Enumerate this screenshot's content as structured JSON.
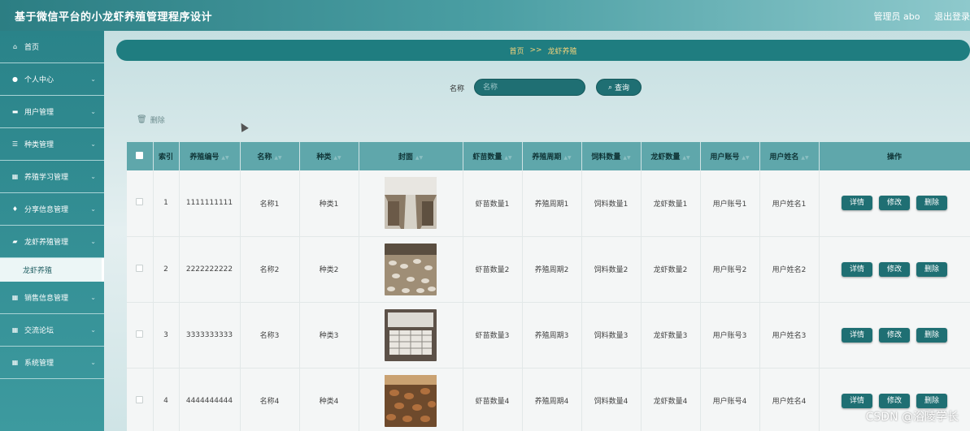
{
  "header": {
    "title": "基于微信平台的小龙虾养殖管理程序设计",
    "user_label": "管理员 abo",
    "logout_label": "退出登录"
  },
  "sidebar": {
    "items": [
      {
        "label": "首页",
        "icon": "home-icon"
      },
      {
        "label": "个人中心",
        "icon": "user-icon"
      },
      {
        "label": "用户管理",
        "icon": "id-card-icon"
      },
      {
        "label": "种类管理",
        "icon": "sliders-icon"
      },
      {
        "label": "养殖学习管理",
        "icon": "grid-icon"
      },
      {
        "label": "分享信息管理",
        "icon": "pin-icon"
      },
      {
        "label": "龙虾养殖管理",
        "icon": "chat-icon"
      },
      {
        "label": "销售信息管理",
        "icon": "grid-icon"
      },
      {
        "label": "交流论坛",
        "icon": "grid-icon"
      },
      {
        "label": "系统管理",
        "icon": "grid-icon"
      }
    ],
    "active_sub": "龙虾养殖"
  },
  "breadcrumb": {
    "home": "首页",
    "separator": ">>",
    "current": "龙虾养殖"
  },
  "search": {
    "label": "名称",
    "placeholder": "名称",
    "button": "查询"
  },
  "toolbar": {
    "delete_label": "删除"
  },
  "table": {
    "headers": [
      "索引",
      "养殖编号",
      "名称",
      "种类",
      "封面",
      "虾苗数量",
      "养殖周期",
      "饲料数量",
      "龙虾数量",
      "用户账号",
      "用户姓名",
      "操作"
    ],
    "rows": [
      {
        "index": "1",
        "code": "1111111111",
        "name": "名称1",
        "kind": "种类1",
        "seedling": "虾苗数量1",
        "cycle": "养殖周期1",
        "feed": "饲料数量1",
        "crayfish": "龙虾数量1",
        "account": "用户账号1",
        "username": "用户姓名1"
      },
      {
        "index": "2",
        "code": "2222222222",
        "name": "名称2",
        "kind": "种类2",
        "seedling": "虾苗数量2",
        "cycle": "养殖周期2",
        "feed": "饲料数量2",
        "crayfish": "龙虾数量2",
        "account": "用户账号2",
        "username": "用户姓名2"
      },
      {
        "index": "3",
        "code": "3333333333",
        "name": "名称3",
        "kind": "种类3",
        "seedling": "虾苗数量3",
        "cycle": "养殖周期3",
        "feed": "饲料数量3",
        "crayfish": "龙虾数量3",
        "account": "用户账号3",
        "username": "用户姓名3"
      },
      {
        "index": "4",
        "code": "4444444444",
        "name": "名称4",
        "kind": "种类4",
        "seedling": "虾苗数量4",
        "cycle": "养殖周期4",
        "feed": "饲料数量4",
        "crayfish": "龙虾数量4",
        "account": "用户账号4",
        "username": "用户姓名4"
      }
    ],
    "actions": {
      "detail": "详情",
      "edit": "修改",
      "delete": "删除"
    }
  },
  "watermark": "CSDN @浴陵学长",
  "colors": {
    "primary": "#1f6f73",
    "header": "#2c7e83",
    "table_header": "#5fa7ab",
    "breadcrumb_text": "#f3d37a"
  }
}
